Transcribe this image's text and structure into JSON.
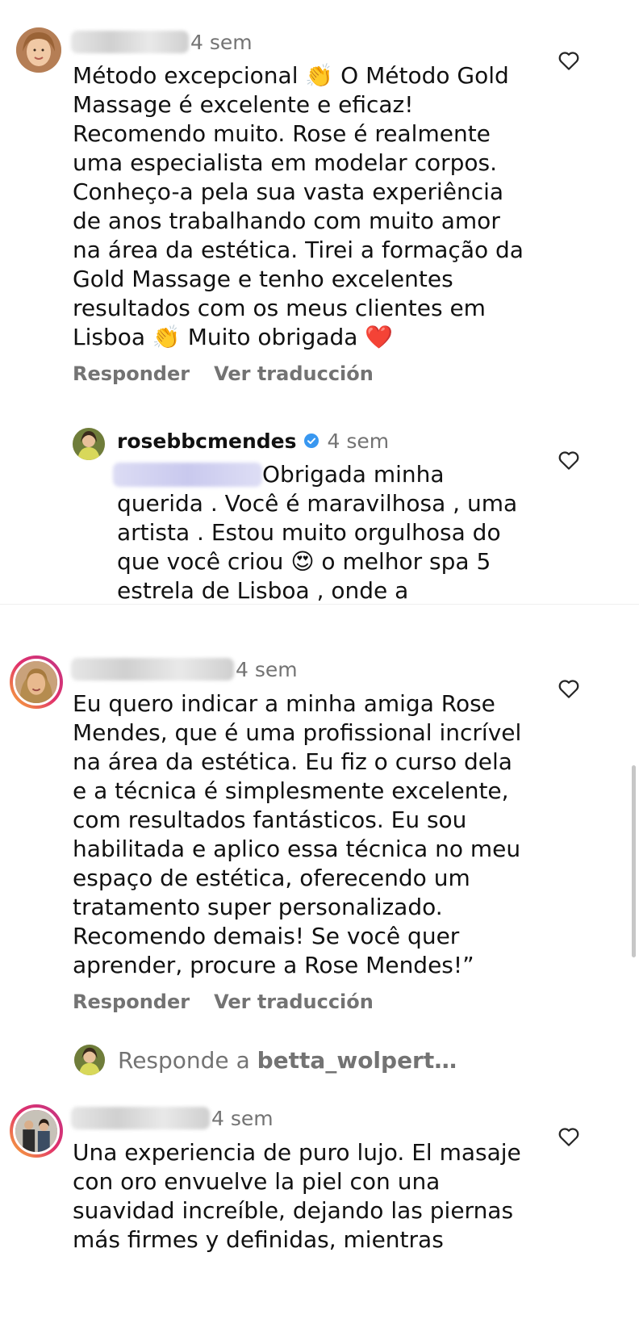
{
  "comments": [
    {
      "time": "4 sem",
      "text": "Método excepcional 👏 O Método Gold\nMassage é excelente e eficaz!\nRecomendo muito. Rose é realmente\numa especialista em modelar corpos.\nConheço-a pela sua vasta experiência\nde anos trabalhando com muito amor\nna área da estética. Tirei a formação da\nGold Massage e tenho excelentes\nresultados com os meus clientes em\nLisboa 👏 Muito obrigada ❤️",
      "reply_label": "Responder",
      "translate_label": "Ver traducción"
    },
    {
      "time": "4 sem",
      "text": "Eu quero indicar a minha amiga Rose\nMendes, que é uma profissional incrível\nna área da estética. Eu fiz o curso dela\ne a técnica é simplesmente excelente,\ncom resultados fantásticos. Eu sou\nhabilitada e aplico essa técnica no meu\nespaço de estética, oferecendo um\ntratamento super personalizado.\nRecomendo demais! Se você quer\naprender, procure a Rose Mendes!”",
      "reply_label": "Responder",
      "translate_label": "Ver traducción"
    },
    {
      "time": "4 sem",
      "text": "Una experiencia de puro lujo. El masaje\ncon oro envuelve la piel con una\nsuavidad increíble, dejando las piernas\nmás firmes y definidas, mientras"
    }
  ],
  "reply": {
    "username": "rosebbcmendes",
    "time": "4 sem",
    "text": "Obrigada minha\nquerida . Você é maravilhosa , uma\nartista . Estou muito  orgulhosa do\nque você criou 😍 o melhor spa 5\nestrela de  Lisboa , onde a"
  },
  "view_replies": {
    "prefix": "Responde a ",
    "name": "betta_wolpert…"
  },
  "colors": {
    "secondary_text": "#737373",
    "verified_blue": "#3897f0",
    "story_ring": [
      "#f9b233",
      "#e1306c",
      "#c13584"
    ]
  }
}
